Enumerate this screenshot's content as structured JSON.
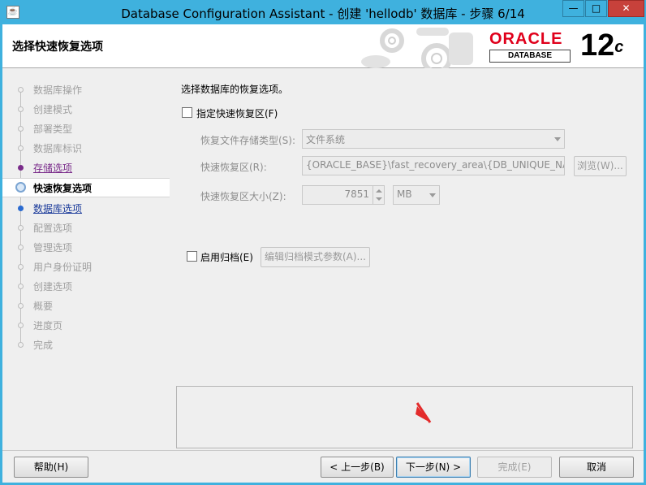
{
  "window": {
    "title": "Database Configuration Assistant - 创建 'hellodb' 数据库 - 步骤 6/14",
    "minimize": "—",
    "maximize": "□",
    "close": "✕"
  },
  "banner": {
    "heading": "选择快速恢复选项",
    "logo_word": "ORACLE",
    "logo_sub": "DATABASE",
    "version": "12",
    "version_suffix": "c"
  },
  "steps": [
    {
      "label": "数据库操作",
      "state": "disabled"
    },
    {
      "label": "创建模式",
      "state": "disabled"
    },
    {
      "label": "部署类型",
      "state": "disabled"
    },
    {
      "label": "数据库标识",
      "state": "disabled"
    },
    {
      "label": "存储选项",
      "state": "visited"
    },
    {
      "label": "快速恢复选项",
      "state": "current"
    },
    {
      "label": "数据库选项",
      "state": "link"
    },
    {
      "label": "配置选项",
      "state": "disabled"
    },
    {
      "label": "管理选项",
      "state": "disabled"
    },
    {
      "label": "用户身份证明",
      "state": "disabled"
    },
    {
      "label": "创建选项",
      "state": "disabled"
    },
    {
      "label": "概要",
      "state": "disabled"
    },
    {
      "label": "进度页",
      "state": "disabled"
    },
    {
      "label": "完成",
      "state": "disabled"
    }
  ],
  "form": {
    "intro": "选择数据库的恢复选项。",
    "fast_recovery_checkbox": "指定快速恢复区(F)",
    "storage_type_label": "恢复文件存储类型(S):",
    "storage_type_value": "文件系统",
    "recovery_area_label": "快速恢复区(R):",
    "recovery_area_value": "{ORACLE_BASE}\\fast_recovery_area\\{DB_UNIQUE_NAME}",
    "browse_button": "浏览(W)...",
    "size_label": "快速恢复区大小(Z):",
    "size_value": "7851",
    "size_unit": "MB",
    "archive_checkbox": "启用归档(E)",
    "archive_params_button": "编辑归档模式参数(A)..."
  },
  "buttons": {
    "help": "帮助(H)",
    "back": "< 上一步(B)",
    "next": "下一步(N) >",
    "finish": "完成(E)",
    "cancel": "取消"
  },
  "colors": {
    "oracle_red": "#e0001b",
    "title_bar": "#3fb1de",
    "close_button": "#c7413b",
    "cursor_red": "#e32b2b"
  }
}
